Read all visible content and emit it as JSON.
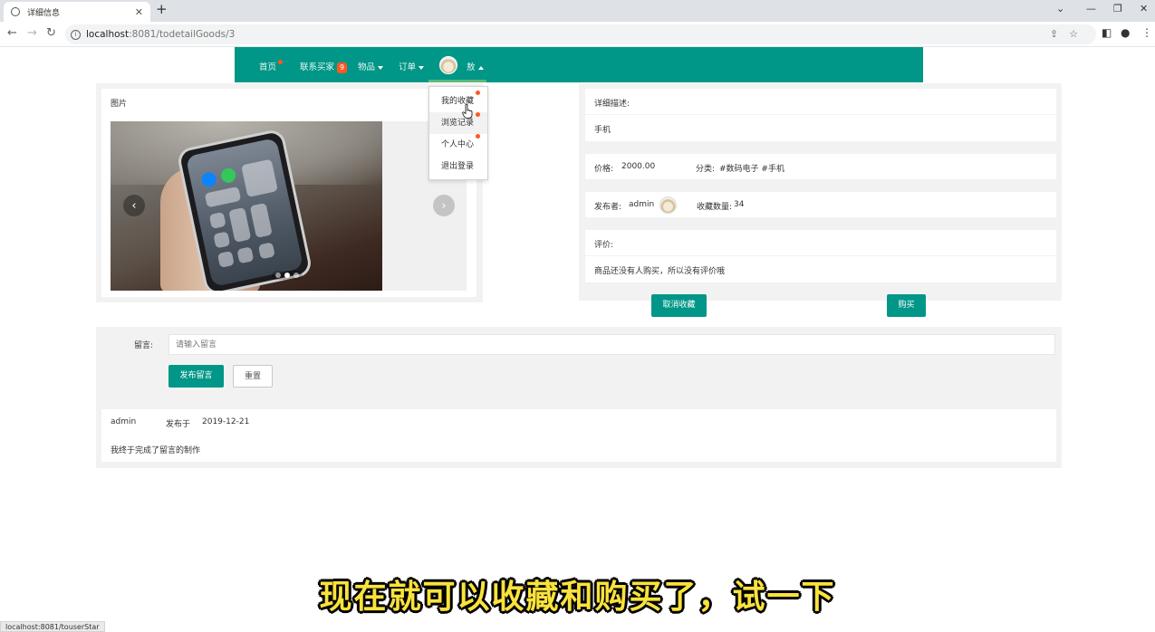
{
  "browser": {
    "tab_title": "详细信息",
    "tab_close": "✕",
    "new_tab": "+",
    "url_host": "localhost",
    "url_path": ":8081/todetailGoods/3",
    "status_url": "localhost:8081/touserStar"
  },
  "nav": {
    "home": "首页",
    "contact_seller": "联系买家",
    "contact_badge": "9",
    "goods": "物品",
    "orders": "订单",
    "username": "敖"
  },
  "dropdown": {
    "items": [
      "我的收藏",
      "浏览记录",
      "个人中心",
      "退出登录"
    ]
  },
  "image_panel": {
    "title": "图片"
  },
  "details": {
    "desc_label": "详细描述:",
    "desc_value": "手机",
    "price_label": "价格:",
    "price_value": "2000.00",
    "category_label": "分类:",
    "category_value": "#数码电子 #手机",
    "publisher_label": "发布者:",
    "publisher_value": "admin",
    "fav_count_label": "收藏数量:",
    "fav_count_value": "34",
    "review_label": "评价:",
    "review_value": "商品还没有人购买，所以没有评价哦"
  },
  "actions": {
    "unfavorite": "取消收藏",
    "buy": "购买"
  },
  "comment_form": {
    "label": "留言:",
    "placeholder": "请输入留言",
    "submit": "发布留言",
    "reset": "重置"
  },
  "comments": [
    {
      "user": "admin",
      "posted_label": "发布于",
      "date": "2019-12-21",
      "text": "我终于完成了留言的制作"
    }
  ],
  "subtitle": "现在就可以收藏和购买了，试一下",
  "colors": {
    "primary": "#009688",
    "badge": "#ff5722",
    "panel_bg": "#f2f2f2"
  }
}
